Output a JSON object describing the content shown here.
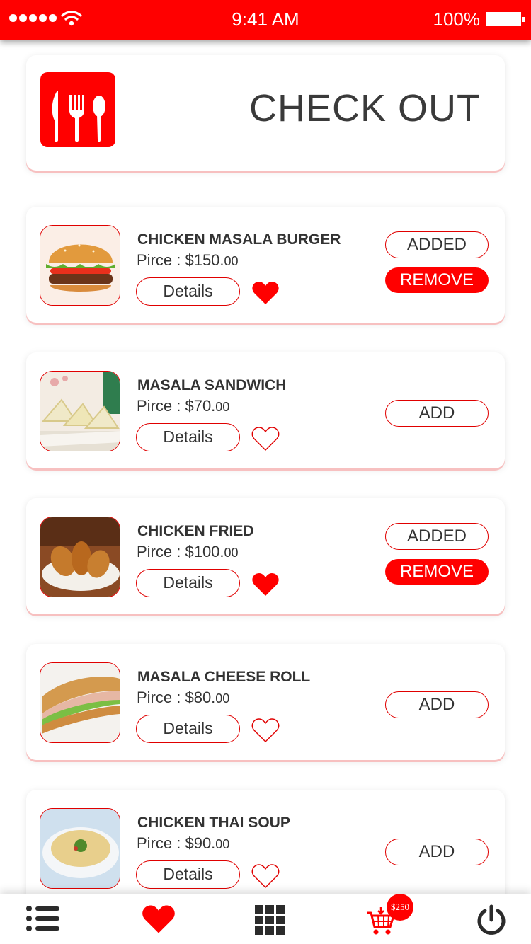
{
  "status_bar": {
    "time": "9:41 AM",
    "battery": "100%"
  },
  "header": {
    "title": "CHECK OUT",
    "logo_icon": "cutlery-icon"
  },
  "colors": {
    "accent": "#ff0000",
    "text": "#333333"
  },
  "price_label": "Pirce : ",
  "details_label": "Details",
  "items": [
    {
      "name": "CHICKEN MASALA BURGER",
      "price": "$150.",
      "cents": "00",
      "favorite": true,
      "status": "ADDED",
      "remove_label": "REMOVE"
    },
    {
      "name": "MASALA SANDWICH",
      "price": "$70.",
      "cents": "00",
      "favorite": false,
      "status": "ADD"
    },
    {
      "name": "CHICKEN FRIED",
      "price": "$100.",
      "cents": "00",
      "favorite": true,
      "status": "ADDED",
      "remove_label": "REMOVE"
    },
    {
      "name": "MASALA CHEESE ROLL",
      "price": "$80.",
      "cents": "00",
      "favorite": false,
      "status": "ADD"
    },
    {
      "name": "CHICKEN THAI SOUP",
      "price": "$90.",
      "cents": "00",
      "favorite": false,
      "status": "ADD"
    }
  ],
  "bottom_nav": {
    "items": [
      "menu-list-icon",
      "heart-icon",
      "grid-icon",
      "cart-icon",
      "power-icon"
    ],
    "cart_total": "$250"
  }
}
